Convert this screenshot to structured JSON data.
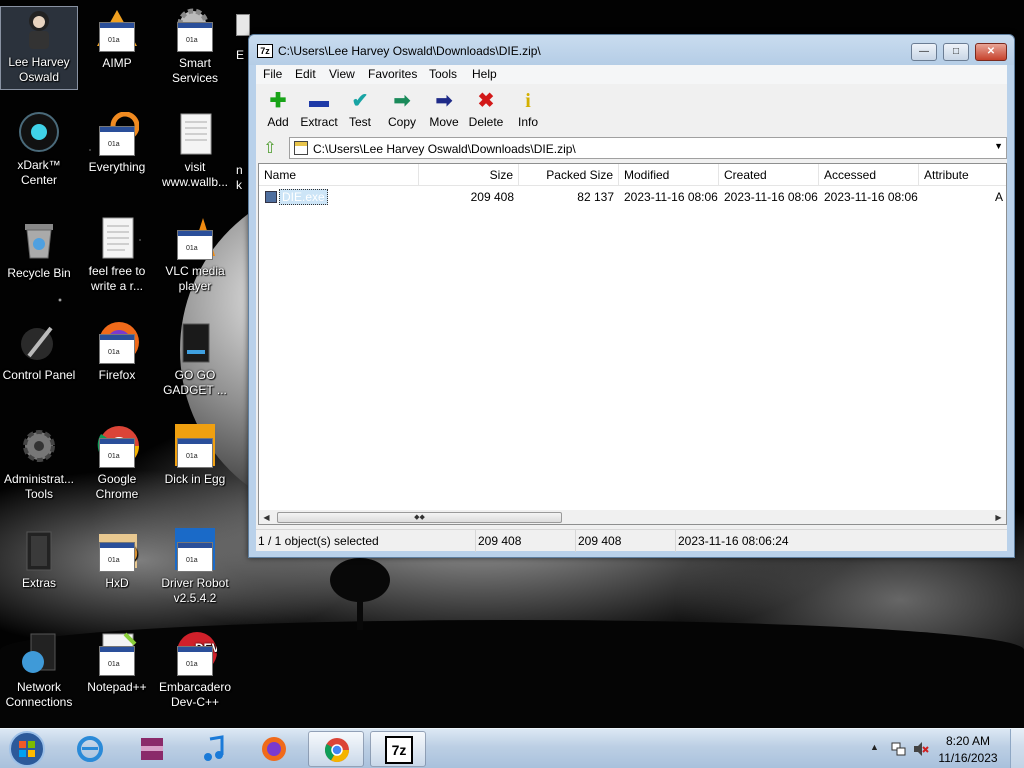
{
  "desktop_icons": [
    {
      "label": "Lee Harvey Oswald",
      "icon": "user-folder-icon"
    },
    {
      "label": "AIMP",
      "icon": "aimp-icon"
    },
    {
      "label": "Smart Services",
      "icon": "gear-icon"
    },
    {
      "label": "xDark™ Center",
      "icon": "xdark-icon"
    },
    {
      "label": "Everything",
      "icon": "everything-icon"
    },
    {
      "label": "visit www.wallb...",
      "icon": "text-document-icon"
    },
    {
      "label": "Recycle Bin",
      "icon": "recycle-bin-icon"
    },
    {
      "label": "feel free to write a r...",
      "icon": "text-document-icon"
    },
    {
      "label": "VLC media player",
      "icon": "vlc-icon"
    },
    {
      "label": "Control Panel",
      "icon": "control-panel-icon"
    },
    {
      "label": "Firefox",
      "icon": "firefox-icon"
    },
    {
      "label": "GO GO GADGET ...",
      "icon": "folder-icon"
    },
    {
      "label": "Administrat... Tools",
      "icon": "admin-tools-icon"
    },
    {
      "label": "Google Chrome",
      "icon": "chrome-icon"
    },
    {
      "label": "Dick in Egg",
      "icon": "die-icon"
    },
    {
      "label": "Extras",
      "icon": "folder-icon"
    },
    {
      "label": "HxD",
      "icon": "hxd-icon"
    },
    {
      "label": "Driver Robot v2.5.4.2",
      "icon": "driver-robot-icon"
    },
    {
      "label": "Network Connections",
      "icon": "network-icon"
    },
    {
      "label": "Notepad++",
      "icon": "notepadpp-icon"
    },
    {
      "label": "Embarcadero Dev-C++",
      "icon": "devcpp-icon"
    }
  ],
  "partial_icons": [
    {
      "label": "E",
      "icon": "partial-icon"
    },
    {
      "label": "n",
      "icon": "partial-icon"
    },
    {
      "label": "k",
      "icon": "partial-icon"
    }
  ],
  "window": {
    "logo": "7z",
    "title": "C:\\Users\\Lee Harvey Oswald\\Downloads\\DIE.zip\\",
    "controls": {
      "minimize": "—",
      "maximize": "□",
      "close": "✕"
    },
    "menu": [
      "File",
      "Edit",
      "View",
      "Favorites",
      "Tools",
      "Help"
    ],
    "toolbar": [
      {
        "label": "Add",
        "icon": "plus-icon",
        "glyph": "✚",
        "color": "#18a418"
      },
      {
        "label": "Extract",
        "icon": "minus-icon",
        "glyph": "▬",
        "color": "#1e3aa8"
      },
      {
        "label": "Test",
        "icon": "check-icon",
        "glyph": "✔",
        "color": "#18a4a4"
      },
      {
        "label": "Copy",
        "icon": "double-arrow-icon",
        "glyph": "➡",
        "color": "#1a8a5a"
      },
      {
        "label": "Move",
        "icon": "arrow-right-icon",
        "glyph": "➡",
        "color": "#1e2a88"
      },
      {
        "label": "Delete",
        "icon": "x-icon",
        "glyph": "✖",
        "color": "#d21818"
      },
      {
        "label": "Info",
        "icon": "info-icon",
        "glyph": "i",
        "color": "#d4b000"
      }
    ],
    "address": {
      "path": "C:\\Users\\Lee Harvey Oswald\\Downloads\\DIE.zip\\",
      "dropdown": "▼",
      "up_glyph": "⇧"
    },
    "list": {
      "columns": [
        "Name",
        "Size",
        "Packed Size",
        "Modified",
        "Created",
        "Accessed",
        "Attribute"
      ],
      "rows": [
        {
          "name": "DIE.exe",
          "size": "209 408",
          "packed": "82 137",
          "modified": "2023-11-16 08:06",
          "created": "2023-11-16 08:06",
          "accessed": "2023-11-16 08:06",
          "attributes": "A"
        }
      ]
    },
    "scrollbar": {
      "left": "◀",
      "right": "▶",
      "grip": "◆◆"
    },
    "status": {
      "selection": "1 / 1 object(s) selected",
      "size": "209 408",
      "size2": "209 408",
      "modified": "2023-11-16 08:06:24"
    }
  },
  "taskbar": {
    "items": [
      {
        "icon": "internet-explorer-icon",
        "active": false
      },
      {
        "icon": "winrar-icon",
        "active": false
      },
      {
        "icon": "music-note-icon",
        "active": false
      },
      {
        "icon": "firefox-icon",
        "active": false
      },
      {
        "icon": "chrome-icon",
        "active": true
      },
      {
        "icon": "sevenzip-icon",
        "active": true,
        "label": "7z"
      }
    ],
    "tray": {
      "show_hidden": "▲",
      "time": "8:20 AM",
      "date": "11/16/2023"
    }
  }
}
